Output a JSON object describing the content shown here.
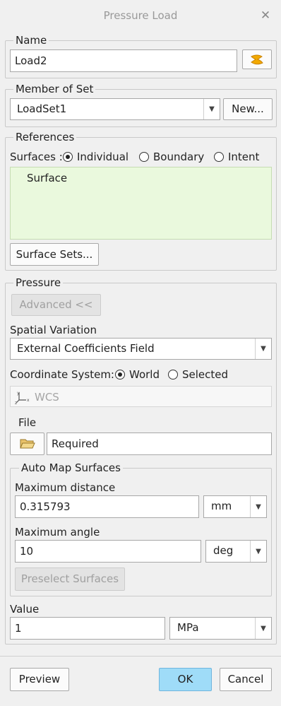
{
  "window": {
    "title": "Pressure Load",
    "close_icon": "close-icon"
  },
  "name_group": {
    "legend": "Name",
    "value": "Load2",
    "icon": "load-icon"
  },
  "member_group": {
    "legend": "Member of Set",
    "selected": "LoadSet1",
    "new_button": "New..."
  },
  "references": {
    "legend": "References",
    "surfaces_label": "Surfaces :",
    "options": [
      "Individual",
      "Boundary",
      "Intent"
    ],
    "selected_option": "Individual",
    "collector_text": "Surface",
    "surface_sets_button": "Surface Sets..."
  },
  "pressure": {
    "legend": "Pressure",
    "advanced_button": "Advanced <<",
    "spatial_variation_label": "Spatial Variation",
    "spatial_variation_value": "External Coefficients Field",
    "coord_system_label": "Coordinate System:",
    "coord_options": [
      "World",
      "Selected"
    ],
    "coord_selected": "World",
    "wcs_text": "WCS",
    "wcs_icon": "coordinate-axes-icon",
    "file_label": "File",
    "file_value": "Required",
    "file_icon": "folder-open-icon",
    "auto_map": {
      "legend": "Auto Map Surfaces",
      "max_distance_label": "Maximum distance",
      "max_distance_value": "0.315793",
      "max_distance_unit": "mm",
      "max_angle_label": "Maximum angle",
      "max_angle_value": "10",
      "max_angle_unit": "deg",
      "preselect_button": "Preselect Surfaces"
    },
    "value_label": "Value",
    "value": "1",
    "value_unit": "MPa"
  },
  "footer": {
    "preview": "Preview",
    "ok": "OK",
    "cancel": "Cancel"
  },
  "colors": {
    "collector_bg": "#eaf9dd",
    "ok_bg": "#9fdcf8",
    "icon_orange": "#f2a900"
  }
}
